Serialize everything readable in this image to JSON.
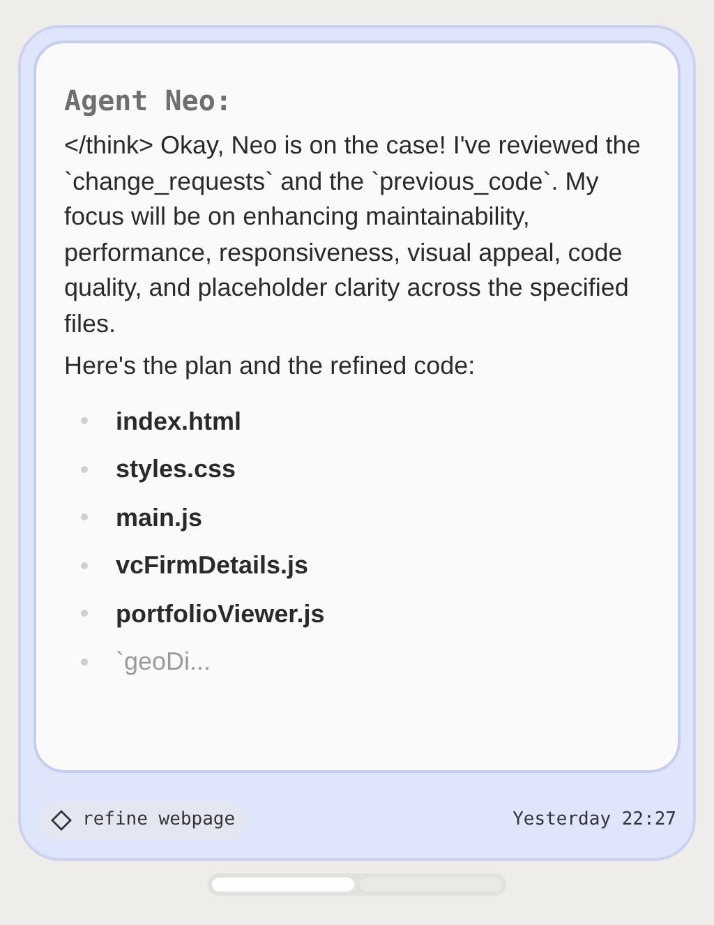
{
  "message": {
    "author": "Agent Neo:",
    "paragraphs": [
      "</think> Okay, Neo is on the case! I've reviewed the `change_requests` and the `previous_code`. My focus will be on enhancing maintainability, performance, responsiveness, visual appeal, code quality, and placeholder clarity across the specified files.",
      "Here's the plan and the refined code:"
    ],
    "files": [
      {
        "name": "index.html",
        "faded": false
      },
      {
        "name": "styles.css",
        "faded": false
      },
      {
        "name": "main.js",
        "faded": false
      },
      {
        "name": "vcFirmDetails.js",
        "faded": false
      },
      {
        "name": "portfolioViewer.js",
        "faded": false
      },
      {
        "name": "`geoDi...",
        "faded": true
      }
    ]
  },
  "tag": "refine webpage",
  "timestamp": "Yesterday 22:27",
  "pager": [
    {
      "selected": true
    },
    {
      "selected": false
    }
  ]
}
